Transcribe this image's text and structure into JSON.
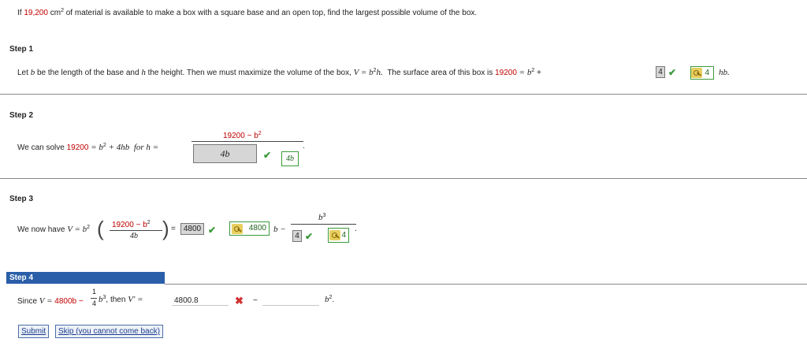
{
  "problem": {
    "t1": "If",
    "amount": "19,200",
    "unit": "cm",
    "unit_exp": "2",
    "t2": "of material is available to make a box with a square base and an open top, find the largest possible volume of the box."
  },
  "step1": {
    "heading": "Step 1",
    "t1": "Let",
    "var_b": "b",
    "t2": "be the length of the base and",
    "var_h": "h",
    "t3": "the height. Then we must maximize the volume of the box,",
    "v_eq": "V = b",
    "exp2": "2",
    "h_dot": "h.",
    "t4": "The surface area of this box is",
    "sa_value": "19200",
    "eq_b": "= b",
    "plus": "+",
    "answer_gray": "4",
    "answer_green": "4",
    "hb": "hb."
  },
  "step2": {
    "heading": "Step 2",
    "t1": "We can solve",
    "sa_value": "19200",
    "eq": "= b",
    "exp2": "2",
    "plus_4hb": "+ 4hb",
    "for_h": "for  h =",
    "num": "19200 − b",
    "den_gray": "4b",
    "den_green": "4b",
    "dot": "."
  },
  "step3": {
    "heading": "Step 3",
    "t1": "We now have",
    "v_eq": "V = b",
    "exp2": "2",
    "frac_num": "19200 − b",
    "frac_den": "4b",
    "eq": "=",
    "answer_gray": "4800",
    "answer_green": "4800",
    "b_minus": "b −",
    "num_b3": "b",
    "exp3": "3",
    "den_gray": "4",
    "den_green": "4",
    "dot": "."
  },
  "step4": {
    "heading": "Step 4",
    "t1": "Since",
    "v_eq": "V =",
    "v_expr": "4800b −",
    "frac_num": "1",
    "frac_den": "4",
    "b3": "b",
    "exp3": "3",
    "then": ",  then",
    "vprime": "V′ =",
    "input1_value": "4800.8",
    "minus": "−",
    "input2_value": "",
    "tail": "b",
    "tail_exp": "2",
    "tail_dot": "."
  },
  "buttons": {
    "submit": "Submit",
    "skip": "Skip (you cannot come back)"
  }
}
